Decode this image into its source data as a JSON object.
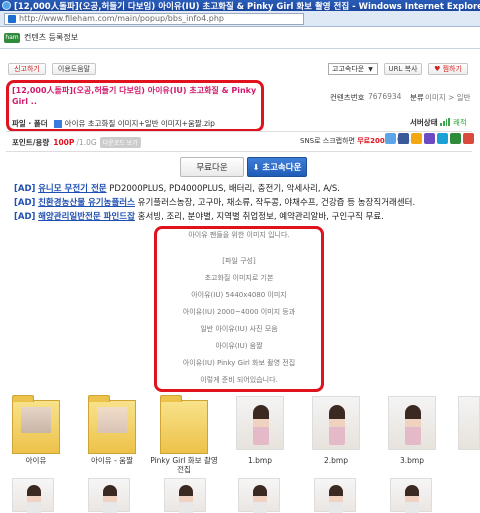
{
  "window": {
    "title": "[12,000人돌파](오공,허들기 다보임) 아이유(IU) 초고화질 & Pinky Girl 화보 촬영 전집 - Windows Internet Explorer"
  },
  "address": {
    "url": "http://www.fileham.com/main/popup/bbs_info4.php"
  },
  "header": {
    "logo_text": "ham",
    "title": "컨텐츠 등록정보"
  },
  "toolbar": {
    "report_label": "신고하기",
    "favorite_label": "이용도움말",
    "select_value": "고고속다운",
    "url_copy_label": "URL 복사",
    "recommend_label": "♥ 찜하기"
  },
  "post": {
    "title": "[12,000人돌파](오공,허들기 다보임) 아이유(IU) 초고화질 & Pinky Girl ..",
    "content_id_label": "컨텐츠번호",
    "content_id": "7676934",
    "category_label": "분류",
    "category_value": "이미지 > 일반",
    "file_label": "파일 · 폴더",
    "file_value": "아이유 초고화질 이미지+일반 이미지+움짤.zip",
    "server_label": "서버상태",
    "server_value": "쾌적"
  },
  "points": {
    "label": "포인트/용량",
    "value": "100P",
    "size": "/1.0G",
    "badge": "다운로드 보기"
  },
  "sns": {
    "text": "SNS로 스크랩하면",
    "highlight": "무료2000P",
    "suffix": "받자!"
  },
  "download": {
    "free_label": "무료다운",
    "fast_label": "초고속다운"
  },
  "ads": [
    {
      "tag": "[AD]",
      "name": "유니모 무전기 전문",
      "desc": "PD2000PLUS, PD4000PLUS, 배터리, 충전기, 악세사리, A/S."
    },
    {
      "tag": "[AD]",
      "name": "친환경농산물 유기농플러스",
      "desc": "유기플러스농장, 고구마, 채소류, 작두콩, 야채수프, 건강즙 등 농장직거래센터."
    },
    {
      "tag": "[AD]",
      "name": "해양관리일반전문 파인드잡",
      "desc": "홍서빙, 조리, 분야별, 지역별 취업정보, 예약관리알바, 구인구직 무료."
    }
  ],
  "description": {
    "lines": [
      "아이유 팬들을 위한 이미지 입니다.",
      "",
      "[파일 구성]",
      "초고화질 이미지로 기본",
      "아이유(IU) 5440x4080 이미지",
      "아이유(IU) 2000~4000 이미지 등과",
      "일반 아이유(IU) 사진 모음",
      "아이유(IU) 움짤",
      "아이유(IU) Pinky Girl 화보 촬영 전집",
      "이렇게 준비 되어있습니다."
    ]
  },
  "thumbnails": [
    {
      "label": "아이유",
      "type": "folder"
    },
    {
      "label": "아이유 - 움짤",
      "type": "folder"
    },
    {
      "label": "Pinky Girl 화보 촬영 전집",
      "type": "folder"
    },
    {
      "label": "1.bmp",
      "type": "photo"
    },
    {
      "label": "2.bmp",
      "type": "photo"
    },
    {
      "label": "3.bmp",
      "type": "photo"
    }
  ]
}
